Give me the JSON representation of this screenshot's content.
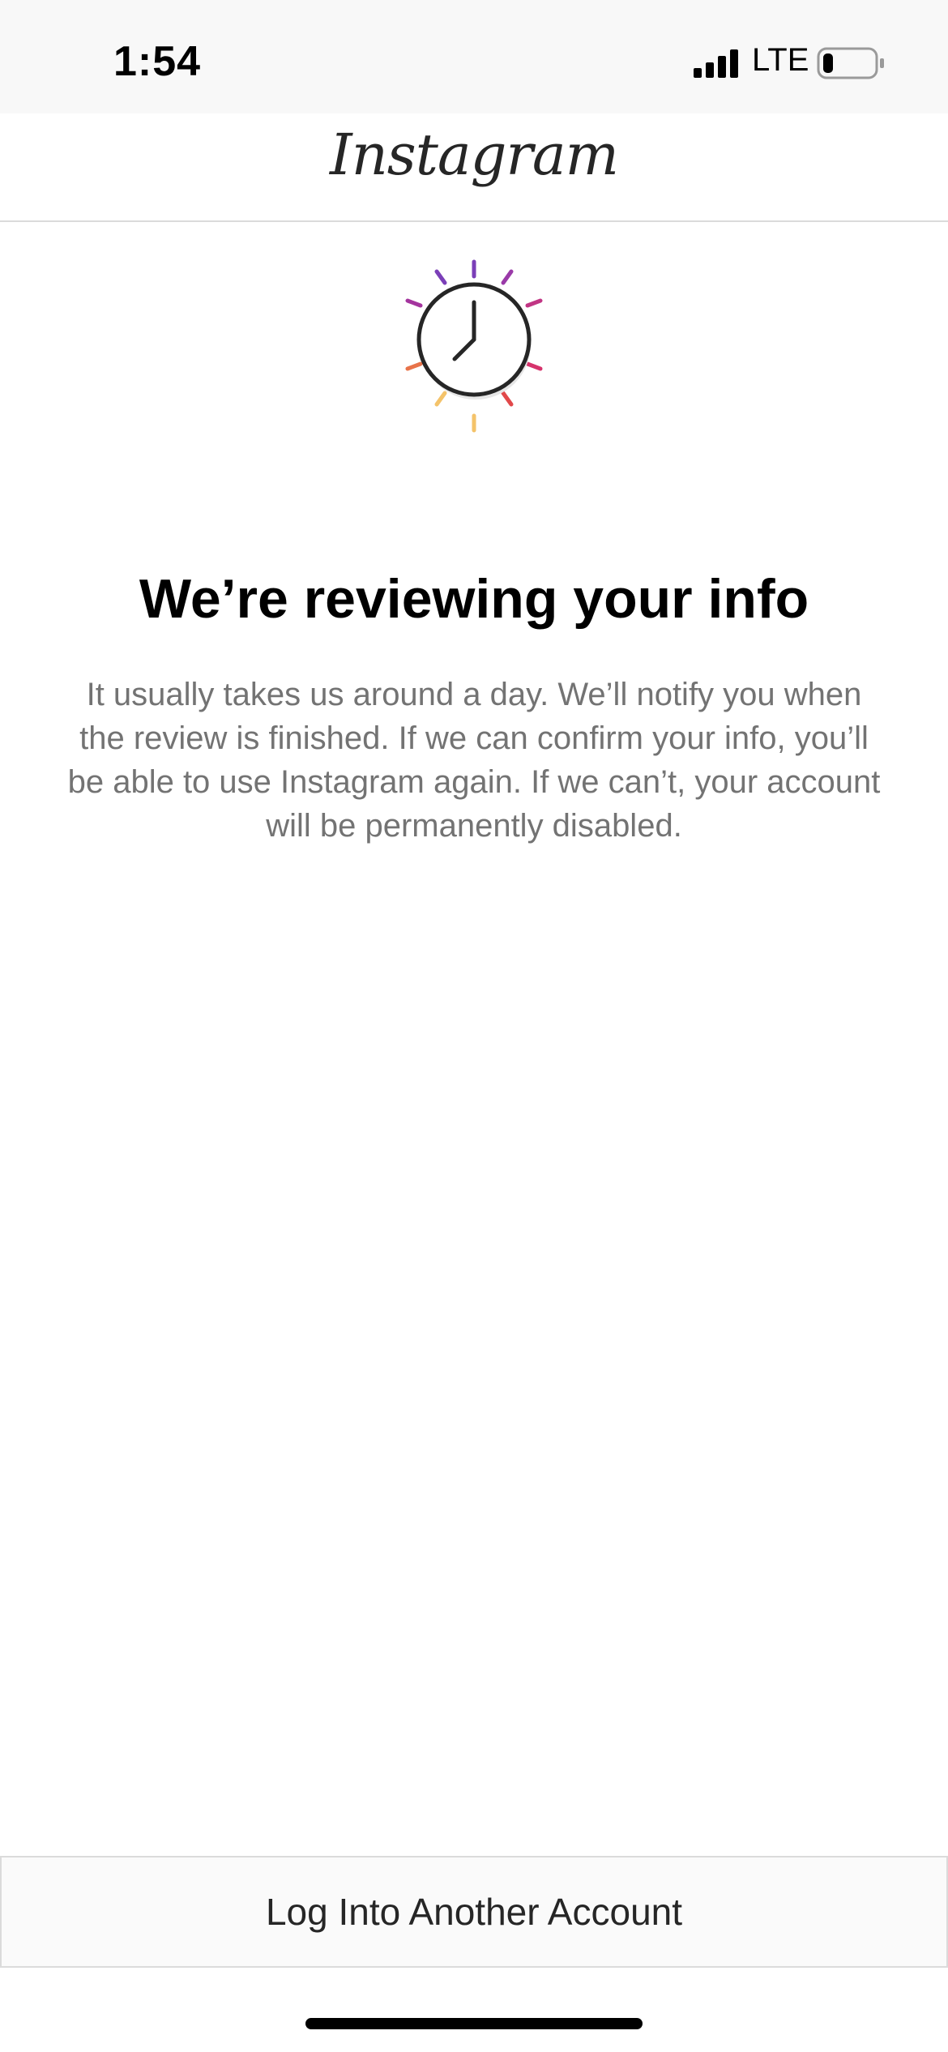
{
  "status_bar": {
    "time": "1:54",
    "network": "LTE",
    "battery_level": 0.2
  },
  "header": {
    "logo_text": "Instagram"
  },
  "review": {
    "icon": "clock-icon",
    "title": "We’re reviewing your info",
    "description": "It usually takes us around a day. We’ll notify you when the review is finished. If we can confirm your info, you’ll be able to use Instagram again. If we can’t, your account will be permanently disabled."
  },
  "footer": {
    "button_label": "Log Into Another Account"
  },
  "colors": {
    "ray_purple": "#7b3fb8",
    "ray_magenta": "#c13584",
    "ray_pink": "#d6336c",
    "ray_red": "#e1484a",
    "ray_orange": "#e8734a",
    "ray_yellow": "#f4c36a",
    "text_secondary": "#737373",
    "border": "#dbdbdb"
  }
}
